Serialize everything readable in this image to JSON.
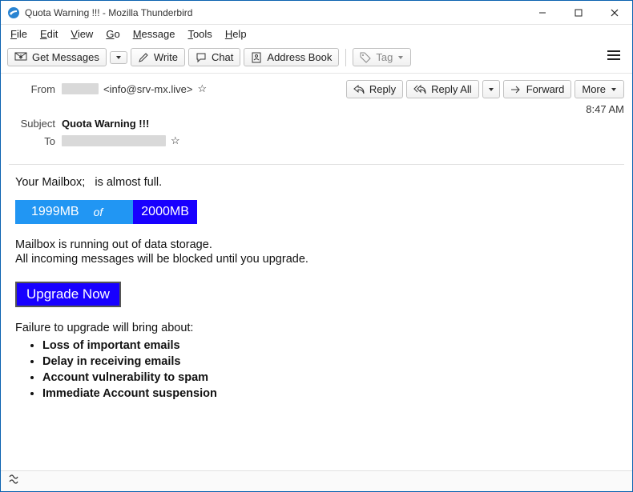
{
  "window": {
    "title": "Quota Warning !!! - Mozilla Thunderbird"
  },
  "menubar": [
    "File",
    "Edit",
    "View",
    "Go",
    "Message",
    "Tools",
    "Help"
  ],
  "toolbar": {
    "get_messages": "Get Messages",
    "write": "Write",
    "chat": "Chat",
    "address_book": "Address Book",
    "tag": "Tag"
  },
  "headers": {
    "from_label": "From",
    "from_addr": "<info@srv-mx.live>",
    "subject_label": "Subject",
    "subject_value": "Quota Warning !!!",
    "to_label": "To",
    "time": "8:47 AM"
  },
  "actions": {
    "reply": "Reply",
    "reply_all": "Reply All",
    "forward": "Forward",
    "more": "More"
  },
  "body": {
    "line_prefix": "Your Mailbox;",
    "line_suffix": "is almost full.",
    "quota_used": "1999MB",
    "quota_of": "of",
    "quota_total": "2000MB",
    "storage_l1": "Mailbox is running out of data storage.",
    "storage_l2": "All incoming messages will be blocked until you upgrade.",
    "upgrade_label": "Upgrade Now",
    "failure_heading": "Failure to upgrade will bring about:",
    "consequences": [
      "Loss of important emails",
      "Delay in receiving emails",
      "Account vulnerability to spam",
      "Immediate Account suspension"
    ]
  }
}
